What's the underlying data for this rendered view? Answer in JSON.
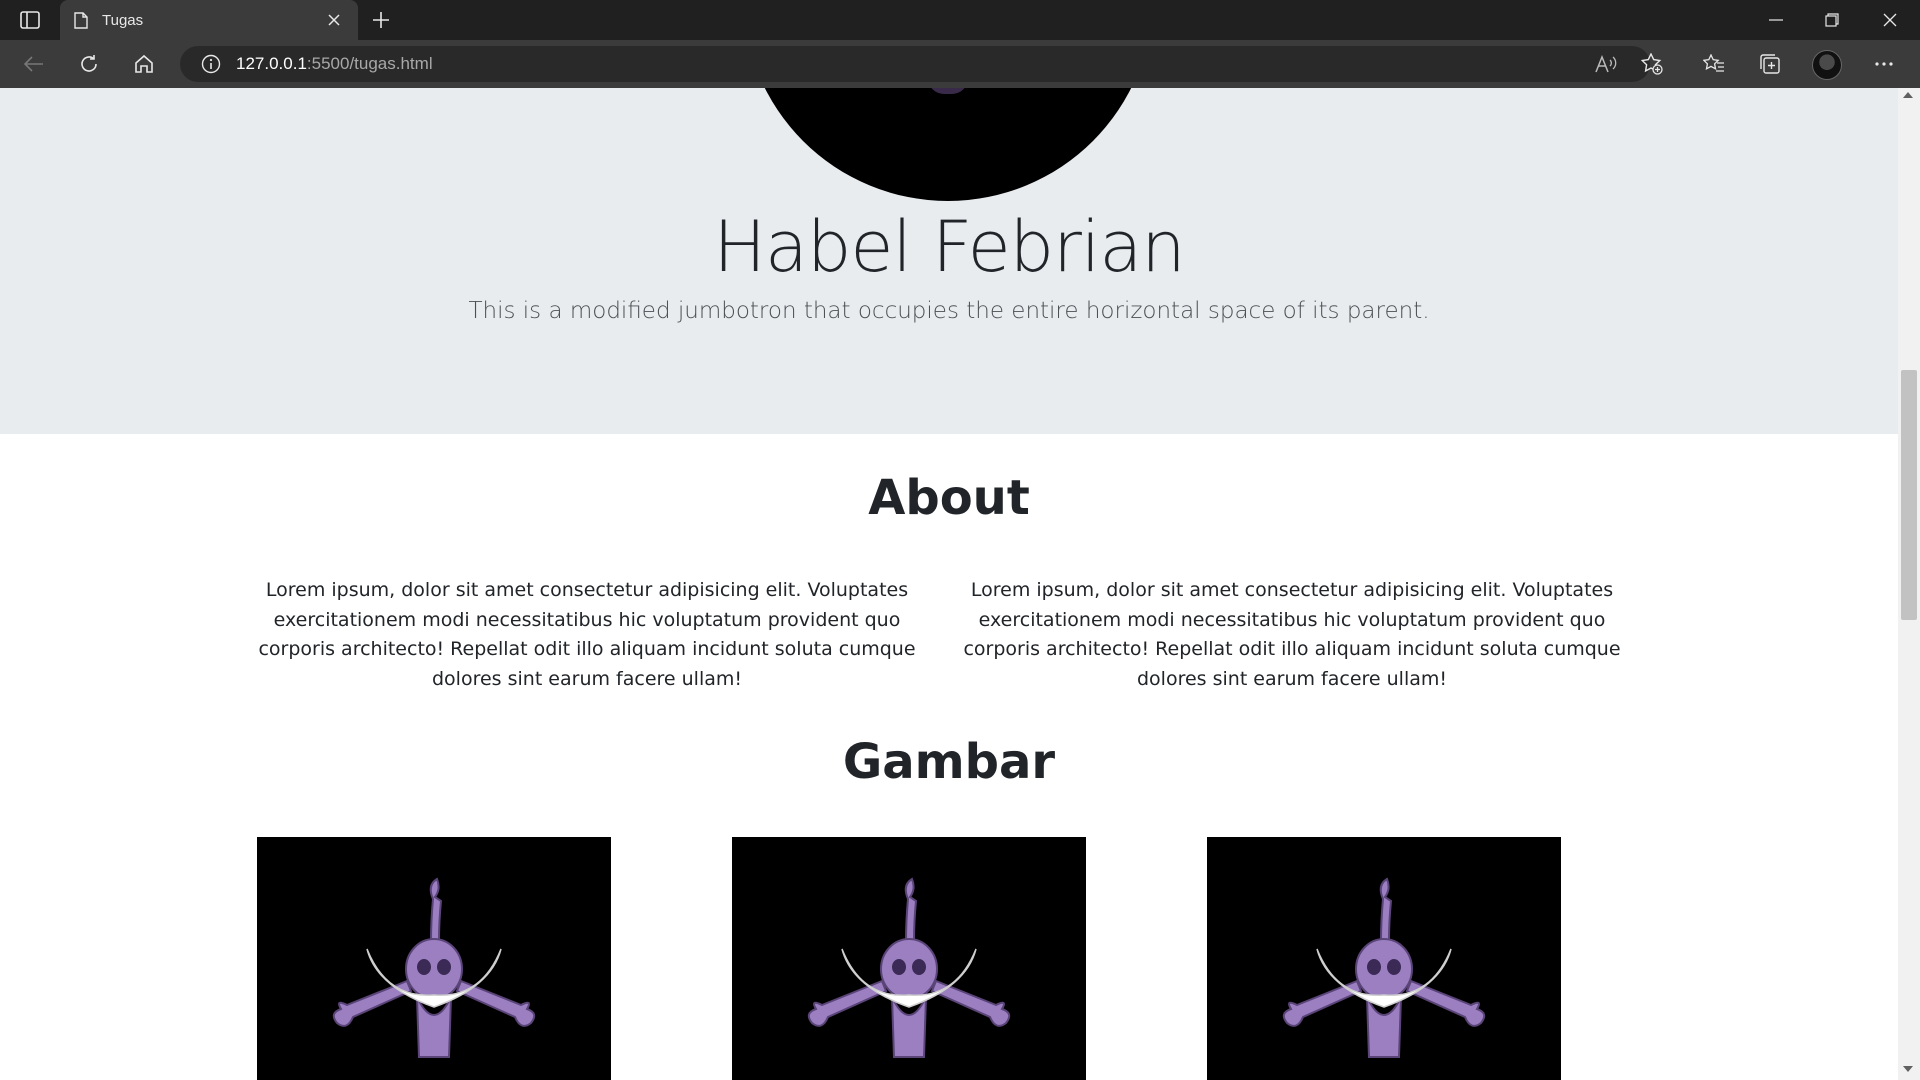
{
  "browser": {
    "tab_title": "Tugas",
    "url_host": "127.0.0.1",
    "url_rest": ":5500/tugas.html"
  },
  "page": {
    "jumbotron": {
      "title": "Habel Febrian",
      "lead": "This is a modified jumbotron that occupies the entire horizontal space of its parent."
    },
    "about": {
      "heading": "About",
      "columns": [
        "Lorem ipsum, dolor sit amet consectetur adipisicing elit. Voluptates exercitationem modi necessitatibus hic voluptatum provident quo corporis architecto! Repellat odit illo aliquam incidunt soluta cumque dolores sint earum facere ullam!",
        "Lorem ipsum, dolor sit amet consectetur adipisicing elit. Voluptates exercitationem modi necessitatibus hic voluptatum provident quo corporis architecto! Repellat odit illo aliquam incidunt soluta cumque dolores sint earum facere ullam!"
      ]
    },
    "gallery": {
      "heading": "Gambar",
      "image_icon": "jolly-roger-skull-icon",
      "image_count": 3
    }
  },
  "colors": {
    "jumbotron_bg": "#e9ecef",
    "chrome_dark": "#202020",
    "toolbar": "#3b3b3b",
    "skull_purple": "#9b7fc1"
  }
}
